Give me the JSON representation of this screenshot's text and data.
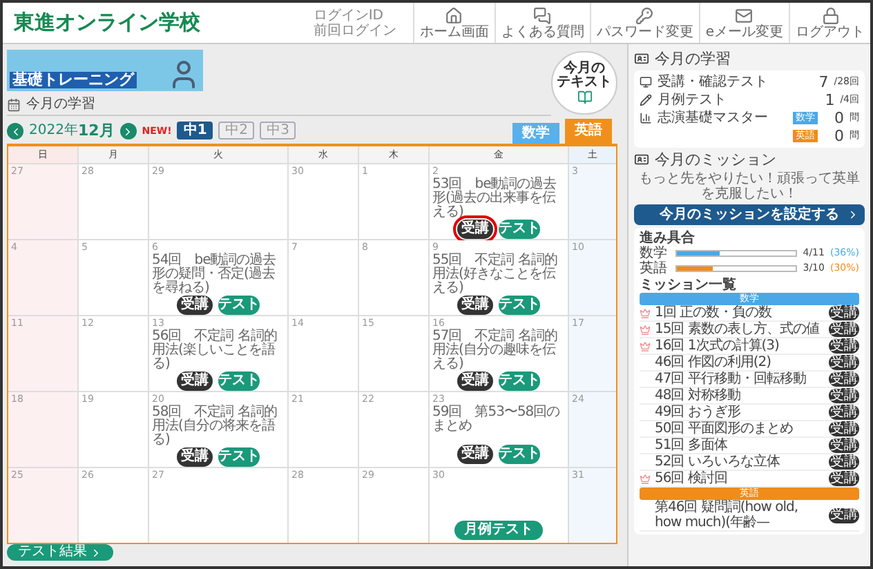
{
  "header": {
    "logo": "東進オンライン学校",
    "login_id_label": "ログインID",
    "last_login_label": "前回ログイン",
    "nav": [
      {
        "label": "ホーム画面"
      },
      {
        "label": "よくある質問"
      },
      {
        "label": "パスワード変更"
      },
      {
        "label": "eメール変更"
      },
      {
        "label": "ログアウト"
      }
    ]
  },
  "banner": {
    "title": "基礎トレーニング"
  },
  "text_button": {
    "lines": [
      "今月の",
      "テキスト"
    ]
  },
  "section_title": "今月の学習",
  "month_nav": {
    "year": "2022年",
    "month": "12月",
    "new_badge": "NEW!",
    "grades": [
      {
        "label": "中1",
        "selected": true
      },
      {
        "label": "中2",
        "selected": false
      },
      {
        "label": "中3",
        "selected": false
      }
    ],
    "subjects": [
      {
        "label": "数学",
        "kind": "math",
        "selected": false
      },
      {
        "label": "英語",
        "kind": "english",
        "selected": true
      }
    ]
  },
  "calendar": {
    "weekdays": [
      "日",
      "月",
      "火",
      "水",
      "木",
      "金",
      "土"
    ],
    "weeks": [
      [
        {
          "day": "27"
        },
        {
          "day": "28"
        },
        {
          "day": "29"
        },
        {
          "day": "30"
        },
        {
          "day": "1"
        },
        {
          "day": "2",
          "lesson": "53回　be動詞の過去形(過去の出来事を伝える)",
          "actions": [
            {
              "label": "受講",
              "kind": "attend",
              "highlighted": true
            },
            {
              "label": "テスト",
              "kind": "test",
              "highlighted": false
            }
          ]
        },
        {
          "day": "3"
        }
      ],
      [
        {
          "day": "4"
        },
        {
          "day": "5"
        },
        {
          "day": "6",
          "lesson": "54回　be動詞の過去形の疑問・否定(過去を尋ねる)",
          "actions": [
            {
              "label": "受講",
              "kind": "attend",
              "highlighted": false
            },
            {
              "label": "テスト",
              "kind": "test",
              "highlighted": false
            }
          ]
        },
        {
          "day": "7"
        },
        {
          "day": "8"
        },
        {
          "day": "9",
          "lesson": "55回　不定詞 名詞的用法(好きなことを伝える)",
          "actions": [
            {
              "label": "受講",
              "kind": "attend",
              "highlighted": false
            },
            {
              "label": "テスト",
              "kind": "test",
              "highlighted": false
            }
          ]
        },
        {
          "day": "10"
        }
      ],
      [
        {
          "day": "11"
        },
        {
          "day": "12"
        },
        {
          "day": "13",
          "lesson": "56回　不定詞 名詞的用法(楽しいことを語る)",
          "actions": [
            {
              "label": "受講",
              "kind": "attend",
              "highlighted": false
            },
            {
              "label": "テスト",
              "kind": "test",
              "highlighted": false
            }
          ]
        },
        {
          "day": "14"
        },
        {
          "day": "15"
        },
        {
          "day": "16",
          "lesson": "57回　不定詞 名詞的用法(自分の趣味を伝える)",
          "actions": [
            {
              "label": "受講",
              "kind": "attend",
              "highlighted": false
            },
            {
              "label": "テスト",
              "kind": "test",
              "highlighted": false
            }
          ]
        },
        {
          "day": "17"
        }
      ],
      [
        {
          "day": "18"
        },
        {
          "day": "19"
        },
        {
          "day": "20",
          "lesson": "58回　不定詞 名詞的用法(自分の将来を語る)",
          "actions": [
            {
              "label": "受講",
              "kind": "attend",
              "highlighted": false
            },
            {
              "label": "テスト",
              "kind": "test",
              "highlighted": false
            }
          ]
        },
        {
          "day": "21"
        },
        {
          "day": "22"
        },
        {
          "day": "23",
          "lesson": "59回　第53〜58回のまとめ",
          "actions": [
            {
              "label": "受講",
              "kind": "attend",
              "highlighted": false
            },
            {
              "label": "テスト",
              "kind": "test",
              "highlighted": false
            }
          ]
        },
        {
          "day": "24"
        }
      ],
      [
        {
          "day": "25"
        },
        {
          "day": "26"
        },
        {
          "day": "27"
        },
        {
          "day": "28"
        },
        {
          "day": "29"
        },
        {
          "day": "30",
          "actions": [
            {
              "label": "月例テスト",
              "kind": "monthly",
              "highlighted": false
            }
          ]
        },
        {
          "day": "31"
        }
      ]
    ]
  },
  "results_button": "テスト結果",
  "side": {
    "study": {
      "title": "今月の学習",
      "items": [
        {
          "label": "受講・確認テスト",
          "value": "7",
          "unit": "/28回"
        },
        {
          "label": "月例テスト",
          "value": "1",
          "unit": "/4回"
        }
      ],
      "master": {
        "label": "志演基礎マスター",
        "rows": [
          {
            "tag": "数学",
            "color": "#4aa8e8",
            "value": "0",
            "unit": "問"
          },
          {
            "tag": "英語",
            "color": "#f08c1a",
            "value": "0",
            "unit": "問"
          }
        ]
      }
    },
    "mission": {
      "title": "今月のミッション",
      "message": "もっと先をやりたい！頑張って英単を克服したい！",
      "set_button": "今月のミッションを設定する",
      "progress": {
        "title": "進み具合",
        "rows": [
          {
            "label": "数学",
            "level": 0.36,
            "reading": "4/11",
            "percent": "(36%)",
            "color": "#4aa8e8"
          },
          {
            "label": "英語",
            "level": 0.3,
            "reading": "3/10",
            "percent": "(30%)",
            "color": "#f08c1a"
          }
        ]
      },
      "list_title": "ミッション一覧",
      "groups": [
        {
          "label": "数学",
          "color": "#4aa8e8",
          "items": [
            {
              "label": "1回 正の数・負の数",
              "flagged": true,
              "button": "受講"
            },
            {
              "label": "15回 素数の表し方、式の値",
              "flagged": true,
              "button": "受講"
            },
            {
              "label": "16回 1次式の計算(3)",
              "flagged": true,
              "button": "受講"
            },
            {
              "label": "46回 作図の利用(2)",
              "flagged": false,
              "button": "受講"
            },
            {
              "label": "47回 平行移動・回転移動",
              "flagged": false,
              "button": "受講"
            },
            {
              "label": "48回 対称移動",
              "flagged": false,
              "button": "受講"
            },
            {
              "label": "49回 おうぎ形",
              "flagged": false,
              "button": "受講"
            },
            {
              "label": "50回 平面図形のまとめ",
              "flagged": false,
              "button": "受講"
            },
            {
              "label": "51回 多面体",
              "flagged": false,
              "button": "受講"
            },
            {
              "label": "52回 いろいろな立体",
              "flagged": false,
              "button": "受講"
            },
            {
              "label": "56回 検討回",
              "flagged": true,
              "button": "受講"
            }
          ]
        },
        {
          "label": "英語",
          "color": "#f08c1a",
          "items": [
            {
              "label": "第46回 疑問詞(how old, how much)(年齢—",
              "flagged": false,
              "button": "受講"
            }
          ]
        }
      ]
    }
  }
}
